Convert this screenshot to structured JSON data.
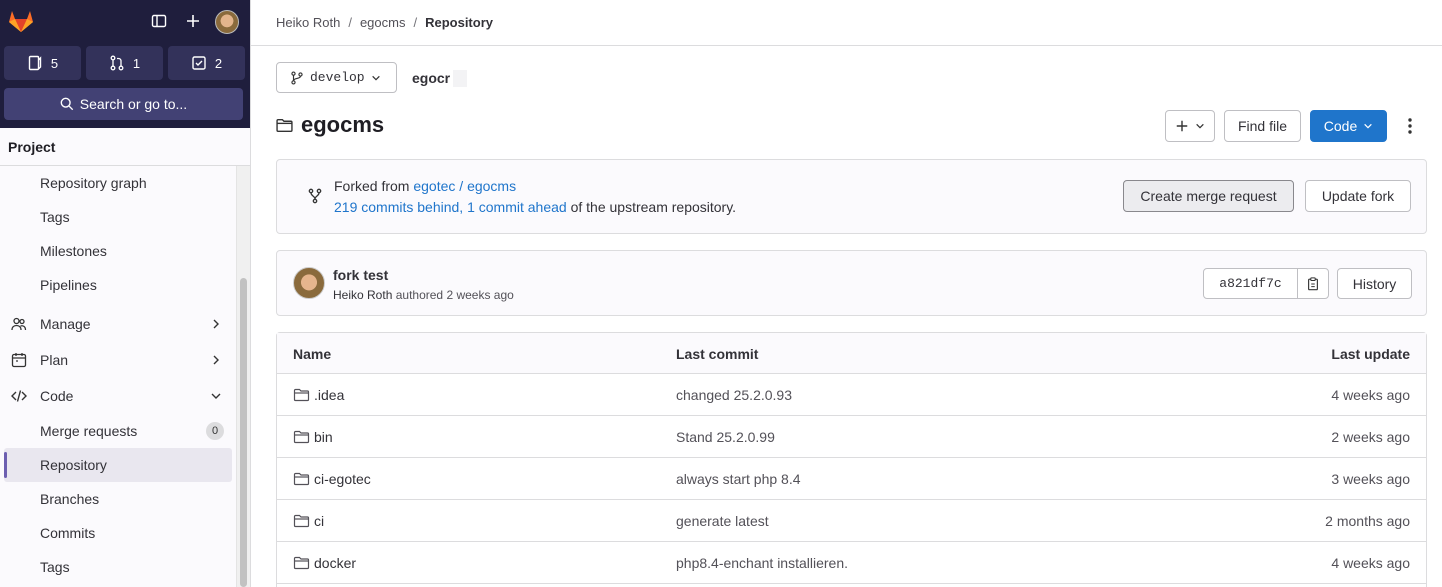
{
  "colors": {
    "sidebar_top": "#1f1e3d",
    "primary": "#1f75cb",
    "link": "#1f75cb",
    "active_indicator": "#6c5fb0"
  },
  "sidebar": {
    "counters": [
      {
        "icon": "issues-icon",
        "count": "5"
      },
      {
        "icon": "merge-request-icon",
        "count": "1"
      },
      {
        "icon": "todo-icon",
        "count": "2"
      }
    ],
    "search_label": "Search or go to...",
    "section_title": "Project",
    "items": [
      {
        "label": "Repository graph"
      },
      {
        "label": "Tags"
      },
      {
        "label": "Milestones"
      },
      {
        "label": "Pipelines"
      }
    ],
    "groups": [
      {
        "label": "Manage",
        "icon": "users-icon"
      },
      {
        "label": "Plan",
        "icon": "calendar-icon"
      },
      {
        "label": "Code",
        "icon": "code-icon"
      }
    ],
    "code_items": [
      {
        "label": "Merge requests",
        "badge": "0"
      },
      {
        "label": "Repository"
      },
      {
        "label": "Branches"
      },
      {
        "label": "Commits"
      },
      {
        "label": "Tags"
      }
    ]
  },
  "breadcrumb": {
    "items": [
      "Heiko Roth",
      "egocms"
    ],
    "current": "Repository"
  },
  "branch": {
    "name": "develop"
  },
  "path_input": "egocr",
  "project": {
    "title": "egocms"
  },
  "buttons": {
    "find_file": "Find file",
    "code": "Code",
    "create_mr": "Create merge request",
    "update_fork": "Update fork",
    "history": "History"
  },
  "fork": {
    "prefix": "Forked from",
    "source": "egotec / egocms",
    "behind": "219 commits behind,",
    "ahead": "1 commit ahead",
    "suffix": "of the upstream repository."
  },
  "commit": {
    "title": "fork test",
    "author": "Heiko Roth",
    "action": "authored",
    "time": "2 weeks ago",
    "sha": "a821df7c"
  },
  "table": {
    "headers": {
      "name": "Name",
      "last_commit": "Last commit",
      "last_update": "Last update"
    },
    "rows": [
      {
        "name": ".idea",
        "commit": "changed 25.2.0.93",
        "date": "4 weeks ago"
      },
      {
        "name": "bin",
        "commit": "Stand 25.2.0.99",
        "date": "2 weeks ago"
      },
      {
        "name": "ci-egotec",
        "commit": "always start php 8.4",
        "date": "3 weeks ago"
      },
      {
        "name": "ci",
        "commit": "generate latest",
        "date": "2 months ago"
      },
      {
        "name": "docker",
        "commit": "php8.4-enchant installieren.",
        "date": "4 weeks ago"
      }
    ]
  }
}
